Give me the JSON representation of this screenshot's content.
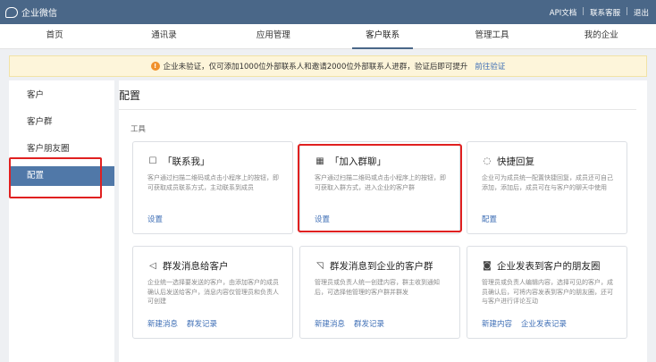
{
  "topbar": {
    "brand": "企业微信",
    "links": [
      "API文档",
      "联系客服",
      "退出"
    ]
  },
  "nav": {
    "items": [
      "首页",
      "通讯录",
      "应用管理",
      "客户联系",
      "管理工具",
      "我的企业"
    ],
    "active": "客户联系"
  },
  "banner": {
    "text": "企业未验证，仅可添加1000位外部联系人和邀请2000位外部联系人进群，验证后即可提升",
    "link": "前往验证"
  },
  "sidebar": {
    "items": [
      "客户",
      "客户群",
      "客户朋友圈",
      "配置"
    ],
    "active": "配置"
  },
  "page": {
    "title": "配置",
    "section": "工具"
  },
  "cards": [
    {
      "icon": "contact-me-icon",
      "title": "「联系我」",
      "desc": "客户通过扫描二维码或点击小程序上的按钮，即可获取成员联系方式，主动联系到成员",
      "links": [
        "设置"
      ]
    },
    {
      "icon": "qr-code-icon",
      "title": "「加入群聊」",
      "desc": "客户通过扫描二维码或点击小程序上的按钮，即可获取入群方式，进入企业的客户群",
      "links": [
        "设置"
      ]
    },
    {
      "icon": "chat-bubble-icon",
      "title": "快捷回复",
      "desc": "企业可为成员统一配置快捷回复，成员还可自己添加，添加后，成员可在与客户的聊天中使用",
      "links": [
        "配置"
      ]
    },
    {
      "icon": "send-icon",
      "title": "群发消息给客户",
      "desc": "企业统一选择要发送的客户，由添加客户的成员确认后发送给客户，消息内容仅管理员和负责人可创建",
      "links": [
        "新建消息",
        "群发记录"
      ]
    },
    {
      "icon": "group-broadcast-icon",
      "title": "群发消息到企业的客户群",
      "desc": "管理员或负责人统一创建内容，群主收到通知后，可选择他管理的客户群并群发",
      "links": [
        "新建消息",
        "群发记录"
      ]
    },
    {
      "icon": "camera-icon",
      "title": "企业发表到客户的朋友圈",
      "desc": "管理员或负责人编辑内容，选择可见的客户，成员确认后，可将内容发表到客户的朋友圈，还可与客户进行评论互动",
      "links": [
        "新建内容",
        "企业发表记录"
      ]
    }
  ]
}
